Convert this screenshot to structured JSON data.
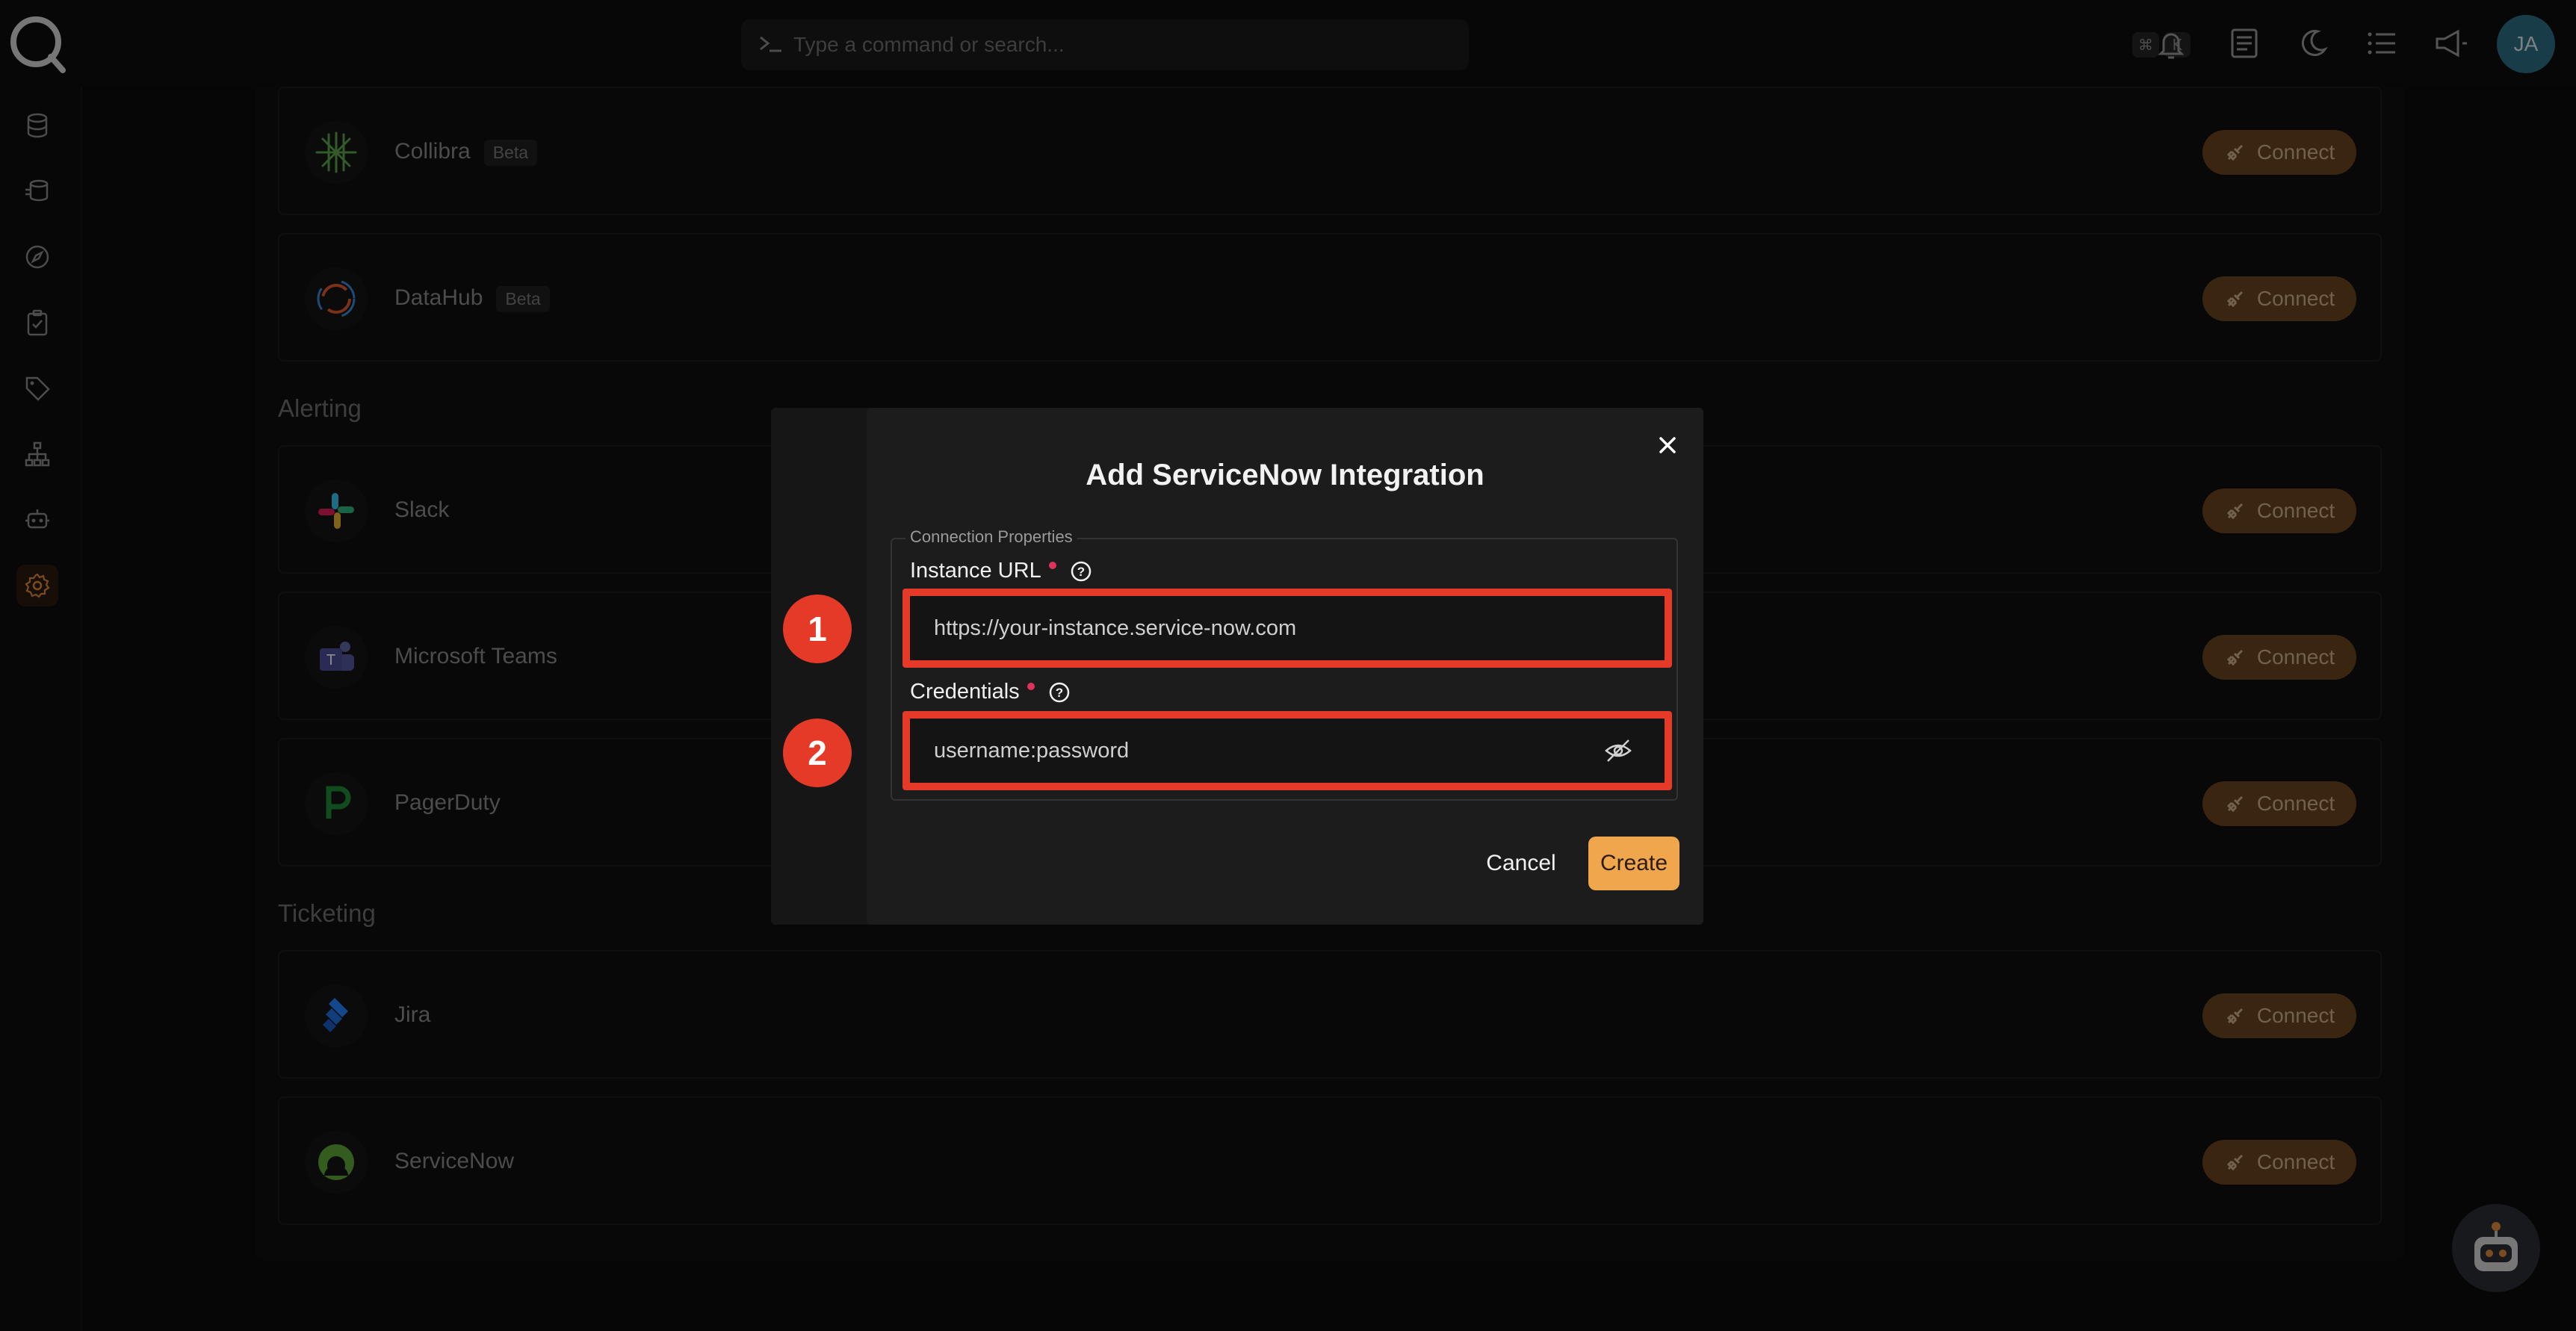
{
  "search": {
    "placeholder": "Type a command or search...",
    "shortcut_mod": "⌘",
    "shortcut_key": "K"
  },
  "user": {
    "initials": "JA"
  },
  "sections": {
    "alerting": "Alerting",
    "ticketing": "Ticketing"
  },
  "integrations": [
    {
      "name": "Collibra",
      "badge": "Beta",
      "action": "Connect"
    },
    {
      "name": "DataHub",
      "badge": "Beta",
      "action": "Connect"
    },
    {
      "name": "Slack",
      "badge": "",
      "action": "Connect"
    },
    {
      "name": "Microsoft Teams",
      "badge": "",
      "action": "Connect"
    },
    {
      "name": "PagerDuty",
      "badge": "",
      "action": "Connect"
    },
    {
      "name": "Jira",
      "badge": "",
      "action": "Connect"
    },
    {
      "name": "ServiceNow",
      "badge": "",
      "action": "Connect"
    }
  ],
  "modal": {
    "title": "Add ServiceNow Integration",
    "fieldset_legend": "Connection Properties",
    "instance_url": {
      "label": "Instance URL",
      "placeholder": "https://your-instance.service-now.com"
    },
    "credentials": {
      "label": "Credentials",
      "placeholder": "username:password"
    },
    "cancel": "Cancel",
    "create": "Create"
  },
  "annotations": [
    "1",
    "2"
  ],
  "colors": {
    "accent": "#f0a64d",
    "highlight": "#e53a27",
    "connect_bg": "#6b4420"
  }
}
